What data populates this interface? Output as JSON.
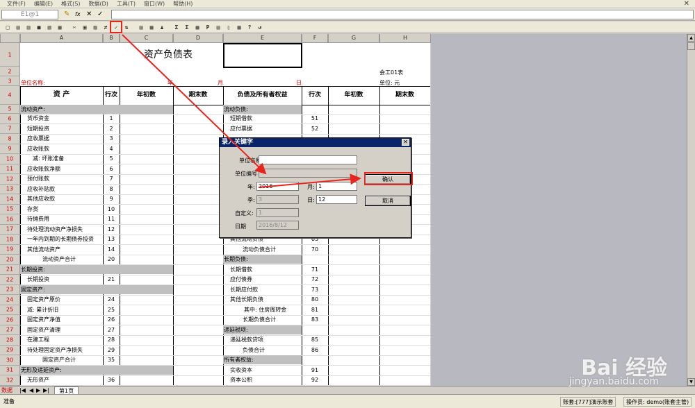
{
  "menu": [
    "文件(F)",
    "编辑(E)",
    "格式(S)",
    "数据(D)",
    "工具(T)",
    "窗口(W)",
    "帮助(H)"
  ],
  "close_glyph": "✕",
  "cell_ref": "E1@1",
  "formula_buttons": [
    "✎",
    "fx",
    "✕",
    "✓"
  ],
  "toolbar_icons": [
    "□",
    "▤",
    "▥",
    "■",
    "▧",
    "▦",
    "✂",
    "▣",
    "▨",
    "≠",
    "✓",
    "⇅",
    "▤",
    "▦",
    "♟",
    "Σ",
    "Σ",
    "▦",
    "P",
    "▤",
    "▯",
    "▦",
    "?",
    "↺"
  ],
  "columns": [
    "A",
    "B",
    "C",
    "D",
    "E",
    "F",
    "G",
    "H"
  ],
  "rows": [
    "1",
    "2",
    "3",
    "4",
    "5",
    "6",
    "7",
    "8",
    "9",
    "10",
    "11",
    "12",
    "13",
    "14",
    "15",
    "16",
    "17",
    "18",
    "19",
    "20",
    "21",
    "22",
    "23",
    "24",
    "25",
    "26",
    "27",
    "28",
    "29",
    "30",
    "31",
    "32"
  ],
  "title": "资产负债表",
  "form_code": "会工01表",
  "unit_label": "单位名称:",
  "year_label": "年",
  "month_label": "月",
  "day_label": "日",
  "currency_label": "单位: 元",
  "headers": [
    "资    产",
    "行次",
    "年初数",
    "期末数",
    "负债及所有者权益",
    "行次",
    "年初数",
    "期末数"
  ],
  "left_items": [
    {
      "name": "流动资产:",
      "line": ""
    },
    {
      "name": "货币资金",
      "line": "1"
    },
    {
      "name": "短期投资",
      "line": "2"
    },
    {
      "name": "应收票据",
      "line": "3"
    },
    {
      "name": "应收账款",
      "line": "4"
    },
    {
      "name": "减: 坏账准备",
      "line": "5"
    },
    {
      "name": "应收账款净额",
      "line": "6"
    },
    {
      "name": "预付账款",
      "line": "7"
    },
    {
      "name": "应收补贴款",
      "line": "8"
    },
    {
      "name": "其他应收款",
      "line": "9"
    },
    {
      "name": "存货",
      "line": "10"
    },
    {
      "name": "待摊费用",
      "line": "11"
    },
    {
      "name": "待处理流动资产净损失",
      "line": "12"
    },
    {
      "name": "一年内到期的长期债券投资",
      "line": "13"
    },
    {
      "name": "其他流动资产",
      "line": "14"
    },
    {
      "name": "流动资产合计",
      "line": "20"
    },
    {
      "name": "长期投资:",
      "line": ""
    },
    {
      "name": "长期投资",
      "line": "21"
    },
    {
      "name": "固定资产:",
      "line": ""
    },
    {
      "name": "固定资产原价",
      "line": "24"
    },
    {
      "name": "减: 累计折旧",
      "line": "25"
    },
    {
      "name": "固定资产净值",
      "line": "26"
    },
    {
      "name": "固定资产清理",
      "line": "27"
    },
    {
      "name": "在建工程",
      "line": "28"
    },
    {
      "name": "待处理固定资产净损失",
      "line": "29"
    },
    {
      "name": "固定资产合计",
      "line": "35"
    },
    {
      "name": "无形及递延资产:",
      "line": ""
    },
    {
      "name": "无形资产",
      "line": "36"
    }
  ],
  "right_items": [
    {
      "name": "流动负债:",
      "line": ""
    },
    {
      "name": "短期借款",
      "line": "51"
    },
    {
      "name": "应付票据",
      "line": "52"
    },
    {
      "name": "其他流动负债",
      "line": "63"
    },
    {
      "name": "流动负债合计",
      "line": "70"
    },
    {
      "name": "长期负债:",
      "line": ""
    },
    {
      "name": "长期借款",
      "line": "71"
    },
    {
      "name": "应付债券",
      "line": "72"
    },
    {
      "name": "长期应付款",
      "line": "73"
    },
    {
      "name": "其他长期负债",
      "line": "80"
    },
    {
      "name": "其中: 住房周转金",
      "line": "81"
    },
    {
      "name": "长期负债合计",
      "line": "83"
    },
    {
      "name": "递延税项:",
      "line": ""
    },
    {
      "name": "递延税款贷项",
      "line": "85"
    },
    {
      "name": "负债合计",
      "line": "86"
    },
    {
      "name": "所有者权益:",
      "line": ""
    },
    {
      "name": "实收资本",
      "line": "91"
    },
    {
      "name": "资本公积",
      "line": "92"
    }
  ],
  "dialog": {
    "title": "录入关键字",
    "unit_name_label": "单位名称",
    "unit_code_label": "单位编号",
    "year_label": "年:",
    "year_value": "2016",
    "month_label": "月:",
    "month_value": "1",
    "quarter_label": "季:",
    "quarter_value": "3",
    "day_label": "日:",
    "day_value": "12",
    "custom_label": "自定义:",
    "custom_value": "1",
    "date_label": "日期",
    "date_value": "2016/8/12",
    "ok": "确认",
    "cancel": "取消"
  },
  "sheet_tab": "第1页",
  "sheet_mode": "数据",
  "status": {
    "ready": "准备",
    "account": "账套:[777]演示账套",
    "operator": "操作员: demo(账套主管)"
  },
  "watermark": {
    "brand": "Bai 经验",
    "url": "jingyan.baidu.com"
  },
  "colors": {
    "accent": "#e8251c",
    "titlebar": "#0a246a",
    "shade": "#c0c0c0"
  }
}
